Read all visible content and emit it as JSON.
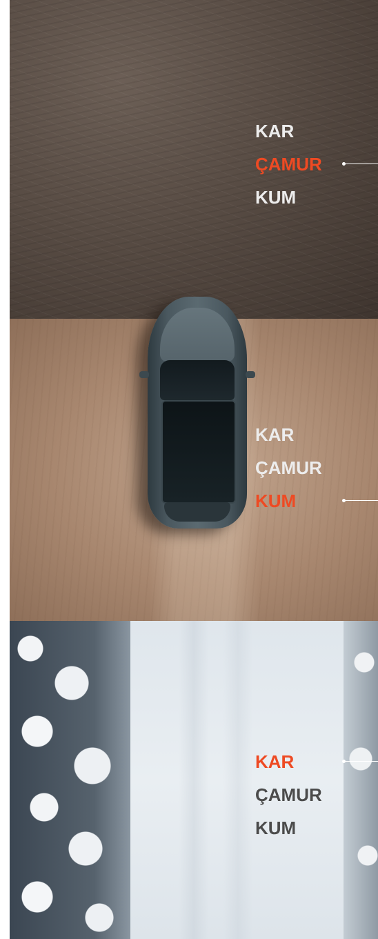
{
  "colors": {
    "accent": "#ee4a23",
    "label_light": "#ededed",
    "label_dark": "#4b4b4b",
    "pointer": "#ffffff"
  },
  "panels": {
    "mud": {
      "labels": [
        "KAR",
        "ÇAMUR",
        "KUM"
      ],
      "active": "ÇAMUR"
    },
    "sand": {
      "labels": [
        "KAR",
        "ÇAMUR",
        "KUM"
      ],
      "active": "KUM"
    },
    "snow": {
      "labels": [
        "KAR",
        "ÇAMUR",
        "KUM"
      ],
      "active": "KAR"
    }
  }
}
